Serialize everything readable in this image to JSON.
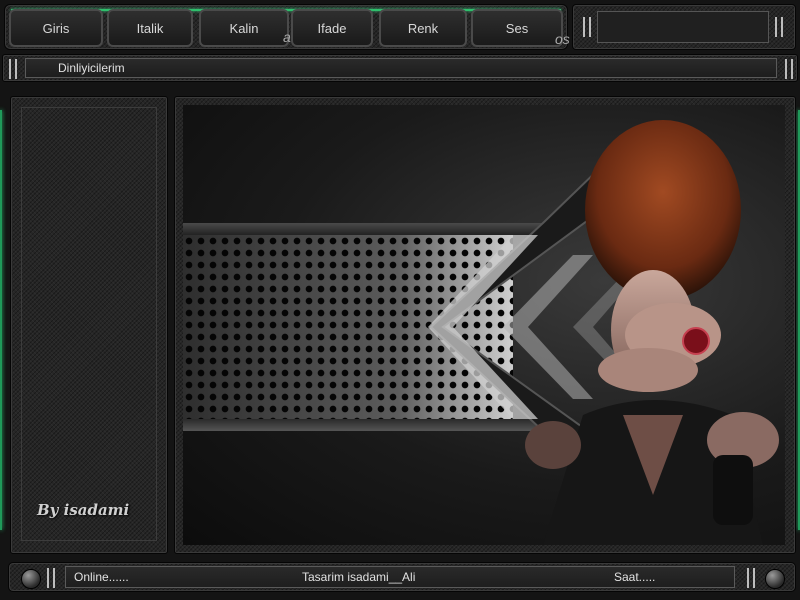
{
  "menu": {
    "items": [
      {
        "label": "Giris"
      },
      {
        "label": "Italik"
      },
      {
        "label": "Kalin"
      },
      {
        "label": "Ifade"
      },
      {
        "label": "Renk"
      },
      {
        "label": "Ses"
      }
    ],
    "deco_a": "a",
    "deco_os": "os"
  },
  "listeners": {
    "label": "Dinliyicilerim"
  },
  "sidebar": {
    "signature": "By isadami"
  },
  "status": {
    "online": "Online......",
    "credit": "Tasarim  isadami__Ali",
    "clock": "Saat....."
  },
  "colors": {
    "accent": "#2fbf6c",
    "panel": "#262626"
  }
}
